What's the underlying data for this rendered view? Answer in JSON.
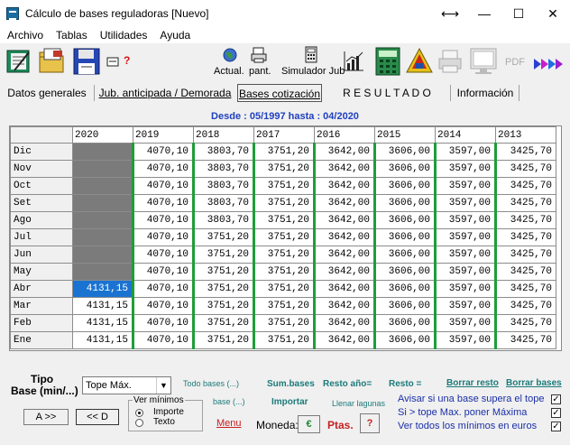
{
  "window": {
    "title": "Cálculo de bases reguladoras   [Nuevo]",
    "controls": {
      "move": "⟷",
      "minimize": "—",
      "maximize": "☐",
      "close": "✕"
    }
  },
  "menu": [
    "Archivo",
    "Tablas",
    "Utilidades",
    "Ayuda"
  ],
  "toolbar": {
    "help_mark": "?",
    "actual_label": "Actual.",
    "pant_label": "pant.",
    "simulador_label": "Simulador Jub",
    "pdf_label": "PDF"
  },
  "tabs": [
    {
      "label": "Datos generales"
    },
    {
      "label": "Jub. anticipada  / Demorada"
    },
    {
      "label": "Bases cotización"
    },
    {
      "label": "R E S U L T A D O"
    },
    {
      "label": "Información"
    }
  ],
  "daterange": "Desde : 05/1997     hasta : 04/2020",
  "grid": {
    "years": [
      "2020",
      "2019",
      "2018",
      "2017",
      "2016",
      "2015",
      "2014",
      "2013"
    ],
    "rows": [
      {
        "month": "Dic",
        "values": [
          "",
          "4070,10",
          "3803,70",
          "3751,20",
          "3642,00",
          "3606,00",
          "3597,00",
          "3425,70"
        ]
      },
      {
        "month": "Nov",
        "values": [
          "",
          "4070,10",
          "3803,70",
          "3751,20",
          "3642,00",
          "3606,00",
          "3597,00",
          "3425,70"
        ]
      },
      {
        "month": "Oct",
        "values": [
          "",
          "4070,10",
          "3803,70",
          "3751,20",
          "3642,00",
          "3606,00",
          "3597,00",
          "3425,70"
        ]
      },
      {
        "month": "Set",
        "values": [
          "",
          "4070,10",
          "3803,70",
          "3751,20",
          "3642,00",
          "3606,00",
          "3597,00",
          "3425,70"
        ]
      },
      {
        "month": "Ago",
        "values": [
          "",
          "4070,10",
          "3803,70",
          "3751,20",
          "3642,00",
          "3606,00",
          "3597,00",
          "3425,70"
        ]
      },
      {
        "month": "Jul",
        "values": [
          "",
          "4070,10",
          "3751,20",
          "3751,20",
          "3642,00",
          "3606,00",
          "3597,00",
          "3425,70"
        ]
      },
      {
        "month": "Jun",
        "values": [
          "",
          "4070,10",
          "3751,20",
          "3751,20",
          "3642,00",
          "3606,00",
          "3597,00",
          "3425,70"
        ]
      },
      {
        "month": "May",
        "values": [
          "",
          "4070,10",
          "3751,20",
          "3751,20",
          "3642,00",
          "3606,00",
          "3597,00",
          "3425,70"
        ]
      },
      {
        "month": "Abr",
        "values": [
          "4131,15",
          "4070,10",
          "3751,20",
          "3751,20",
          "3642,00",
          "3606,00",
          "3597,00",
          "3425,70"
        ]
      },
      {
        "month": "Mar",
        "values": [
          "4131,15",
          "4070,10",
          "3751,20",
          "3751,20",
          "3642,00",
          "3606,00",
          "3597,00",
          "3425,70"
        ]
      },
      {
        "month": "Feb",
        "values": [
          "4131,15",
          "4070,10",
          "3751,20",
          "3751,20",
          "3642,00",
          "3606,00",
          "3597,00",
          "3425,70"
        ]
      },
      {
        "month": "Ene",
        "values": [
          "4131,15",
          "4070,10",
          "3751,20",
          "3751,20",
          "3642,00",
          "3606,00",
          "3597,00",
          "3425,70"
        ]
      }
    ]
  },
  "bottom": {
    "tipo_label": "Tipo",
    "base_label": "Base (min/...)",
    "tipo_selected": "Tope Máx.",
    "todo_bases_1": "Todo  bases (...)",
    "todo_bases_2": "base (...)",
    "sum_bases": "Sum.bases",
    "importar": "Importar",
    "resto_anio": "Resto año=",
    "resto": "Resto =",
    "borrar_resto": "Borrar resto",
    "borrar_bases": "Borrar bases",
    "llenar_lagunas": "Llenar lagunas",
    "ver_minimos": "Ver mínimos",
    "radio_importe": "Importe",
    "radio_texto": "Texto",
    "btn_a": "A  >>",
    "btn_d": "<< D",
    "menu": "Menu",
    "moneda_label": "Moneda:",
    "moneda_symbol": "€",
    "ptas": "Ptas.",
    "ptas_help": "?",
    "opt_avisar": "Avisar si una base supera el tope",
    "opt_si_tope": "Si  > tope Max. poner Máxima",
    "opt_ver_todos": "Ver todos los mínimos en euros",
    "check_mark": "✓"
  }
}
